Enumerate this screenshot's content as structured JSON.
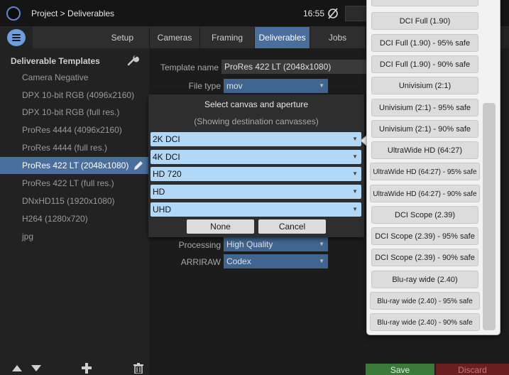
{
  "header": {
    "breadcrumb": "Project > Deliverables",
    "time": "16:55"
  },
  "tabs": [
    {
      "label": "Setup"
    },
    {
      "label": "Cameras"
    },
    {
      "label": "Framing"
    },
    {
      "label": "Deliverables",
      "active": true
    },
    {
      "label": "Jobs"
    }
  ],
  "sidebar": {
    "title": "Deliverable Templates",
    "items": [
      {
        "label": "Camera Negative"
      },
      {
        "label": "DPX 10-bit RGB (4096x2160)"
      },
      {
        "label": "DPX 10-bit RGB (full res.)"
      },
      {
        "label": "ProRes 4444 (4096x2160)"
      },
      {
        "label": "ProRes 4444 (full res.)"
      },
      {
        "label": "ProRes 422 LT (2048x1080)",
        "selected": true
      },
      {
        "label": "ProRes 422 LT (full res.)"
      },
      {
        "label": "DNxHD115 (1920x1080)"
      },
      {
        "label": "H264 (1280x720)"
      },
      {
        "label": "jpg"
      }
    ]
  },
  "form": {
    "template_name_label": "Template name",
    "template_name_value": "ProRes 422 LT (2048x1080)",
    "file_type_label": "File type",
    "file_type_value": "mov",
    "processing_label": "Processing",
    "processing_value": "High Quality",
    "arriraw_label": "ARRIRAW",
    "arriraw_value": "Codex"
  },
  "modal": {
    "title": "Select canvas and aperture",
    "subtitle": "(Showing destination canvasses)",
    "canvases": [
      {
        "label": "2K DCI"
      },
      {
        "label": "4K DCI"
      },
      {
        "label": "HD 720"
      },
      {
        "label": "HD"
      },
      {
        "label": "UHD"
      }
    ],
    "none_label": "None",
    "cancel_label": "Cancel"
  },
  "aperture_options": [
    {
      "label": "DCI Full (1.90)"
    },
    {
      "label": "DCI Full (1.90) - 95% safe"
    },
    {
      "label": "DCI Full (1.90) - 90% safe"
    },
    {
      "label": "Univisium (2:1)"
    },
    {
      "label": "Univisium (2:1) - 95% safe"
    },
    {
      "label": "Univisium (2:1) - 90% safe"
    },
    {
      "label": "UltraWide HD (64:27)"
    },
    {
      "label": "UltraWide HD (64:27) - 95% safe"
    },
    {
      "label": "UltraWide HD (64:27) - 90% safe"
    },
    {
      "label": "DCI Scope (2.39)"
    },
    {
      "label": "DCI Scope (2.39) - 95% safe"
    },
    {
      "label": "DCI Scope (2.39) - 90% safe"
    },
    {
      "label": "Blu-ray wide (2.40)"
    },
    {
      "label": "Blu-ray wide (2.40) - 95% safe"
    },
    {
      "label": "Blu-ray wide (2.40) - 90% safe"
    }
  ],
  "footer": {
    "save_label": "Save",
    "discard_label": "Discard"
  },
  "icons": {
    "logo": "app-logo-icon",
    "status": "slashed-circle-icon",
    "menu": "menu-icon",
    "wrench": "wrench-icon",
    "pencil": "pencil-icon",
    "move_up": "triangle-up-icon",
    "move_down": "triangle-down-icon",
    "add": "plus-icon",
    "delete": "trash-icon"
  },
  "colors": {
    "accent": "#4a6f9c",
    "select_bg": "#b2d8f7",
    "save": "#3c7a3c",
    "discard": "#6a2020"
  }
}
